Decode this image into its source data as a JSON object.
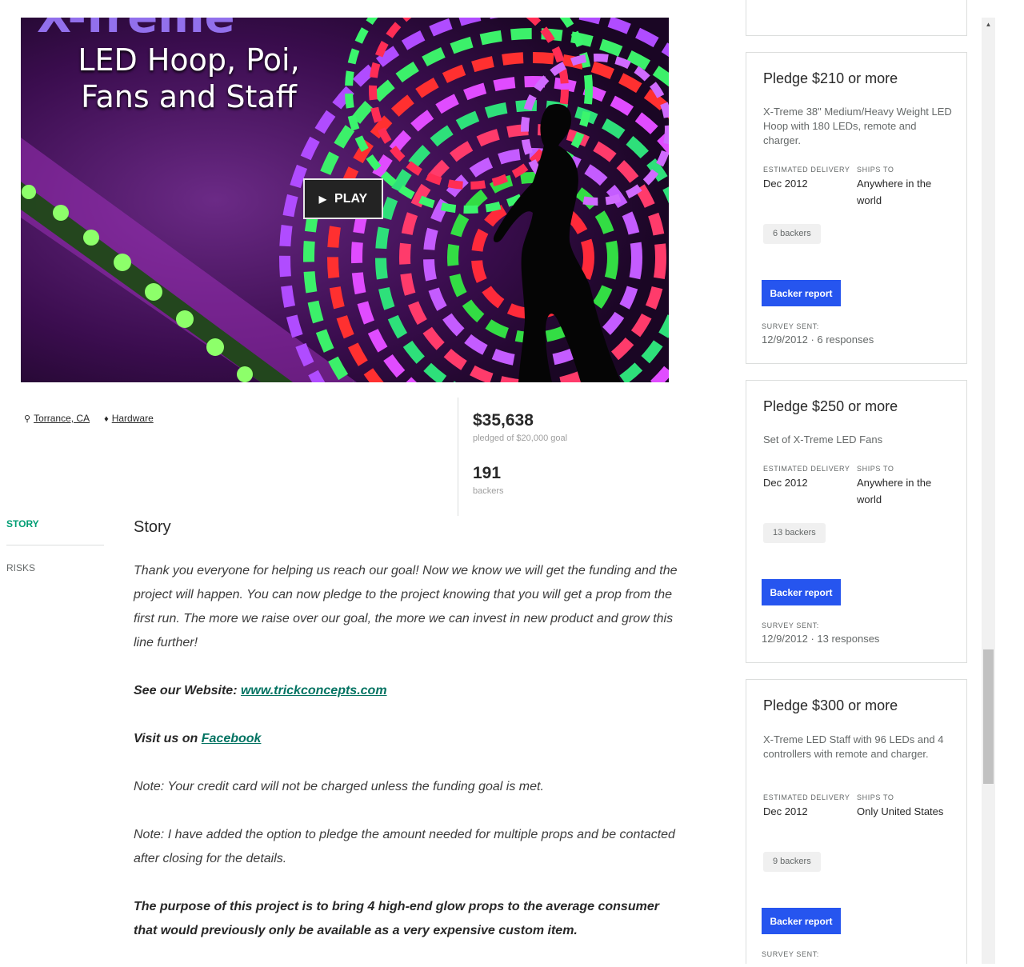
{
  "hero": {
    "title_line1": "LED Hoop, Poi,",
    "title_line2": "Fans and Staff",
    "play_label": "PLAY"
  },
  "meta": {
    "location": "Torrance, CA",
    "category": "Hardware"
  },
  "stats": {
    "pledged": "$35,638",
    "pledged_label": "pledged of $20,000 goal",
    "backers": "191",
    "backers_label": "backers"
  },
  "nav": {
    "story": "STORY",
    "risks": "RISKS"
  },
  "story": {
    "heading": "Story",
    "p1": "Thank you everyone for helping us reach our goal!  Now we know we will get the funding and the project will happen.  You can now pledge to the project knowing that you will get a prop from the first run.  The more we raise over our goal, the more we can invest in new product and grow this line further!",
    "website_prefix": "See our Website:  ",
    "website_link": "www.trickconcepts.com",
    "facebook_prefix": "Visit us on ",
    "facebook_link": "Facebook",
    "note1": "Note:  Your credit card will not be charged unless the funding goal is met.",
    "note2": "Note: I have added the option to pledge the amount needed for multiple props and be contacted after closing for the details.",
    "purpose": "The purpose of this project is to bring 4 high-end glow props to the average consumer that would previously only be available as a very expensive custom item."
  },
  "rewards": {
    "labels": {
      "delivery": "ESTIMATED DELIVERY",
      "ships": "SHIPS TO",
      "report": "Backer report",
      "survey": "SURVEY SENT:"
    },
    "items": [
      {
        "title": "Pledge $210 or more",
        "description": "X-Treme 38\" Medium/Heavy Weight LED Hoop with 180 LEDs, remote and charger.",
        "delivery": "Dec 2012",
        "ships": "Anywhere in the world",
        "backers": "6 backers",
        "survey": "12/9/2012 · 6 responses"
      },
      {
        "title": "Pledge $250 or more",
        "description": "Set of X-Treme LED Fans",
        "delivery": "Dec 2012",
        "ships": "Anywhere in the world",
        "backers": "13 backers",
        "survey": "12/9/2012 · 13 responses"
      },
      {
        "title": "Pledge $300 or more",
        "description": "X-Treme LED Staff with 96 LEDs and 4 controllers with remote and charger.",
        "delivery": "Dec 2012",
        "ships": "Only United States",
        "backers": "9 backers"
      }
    ]
  }
}
